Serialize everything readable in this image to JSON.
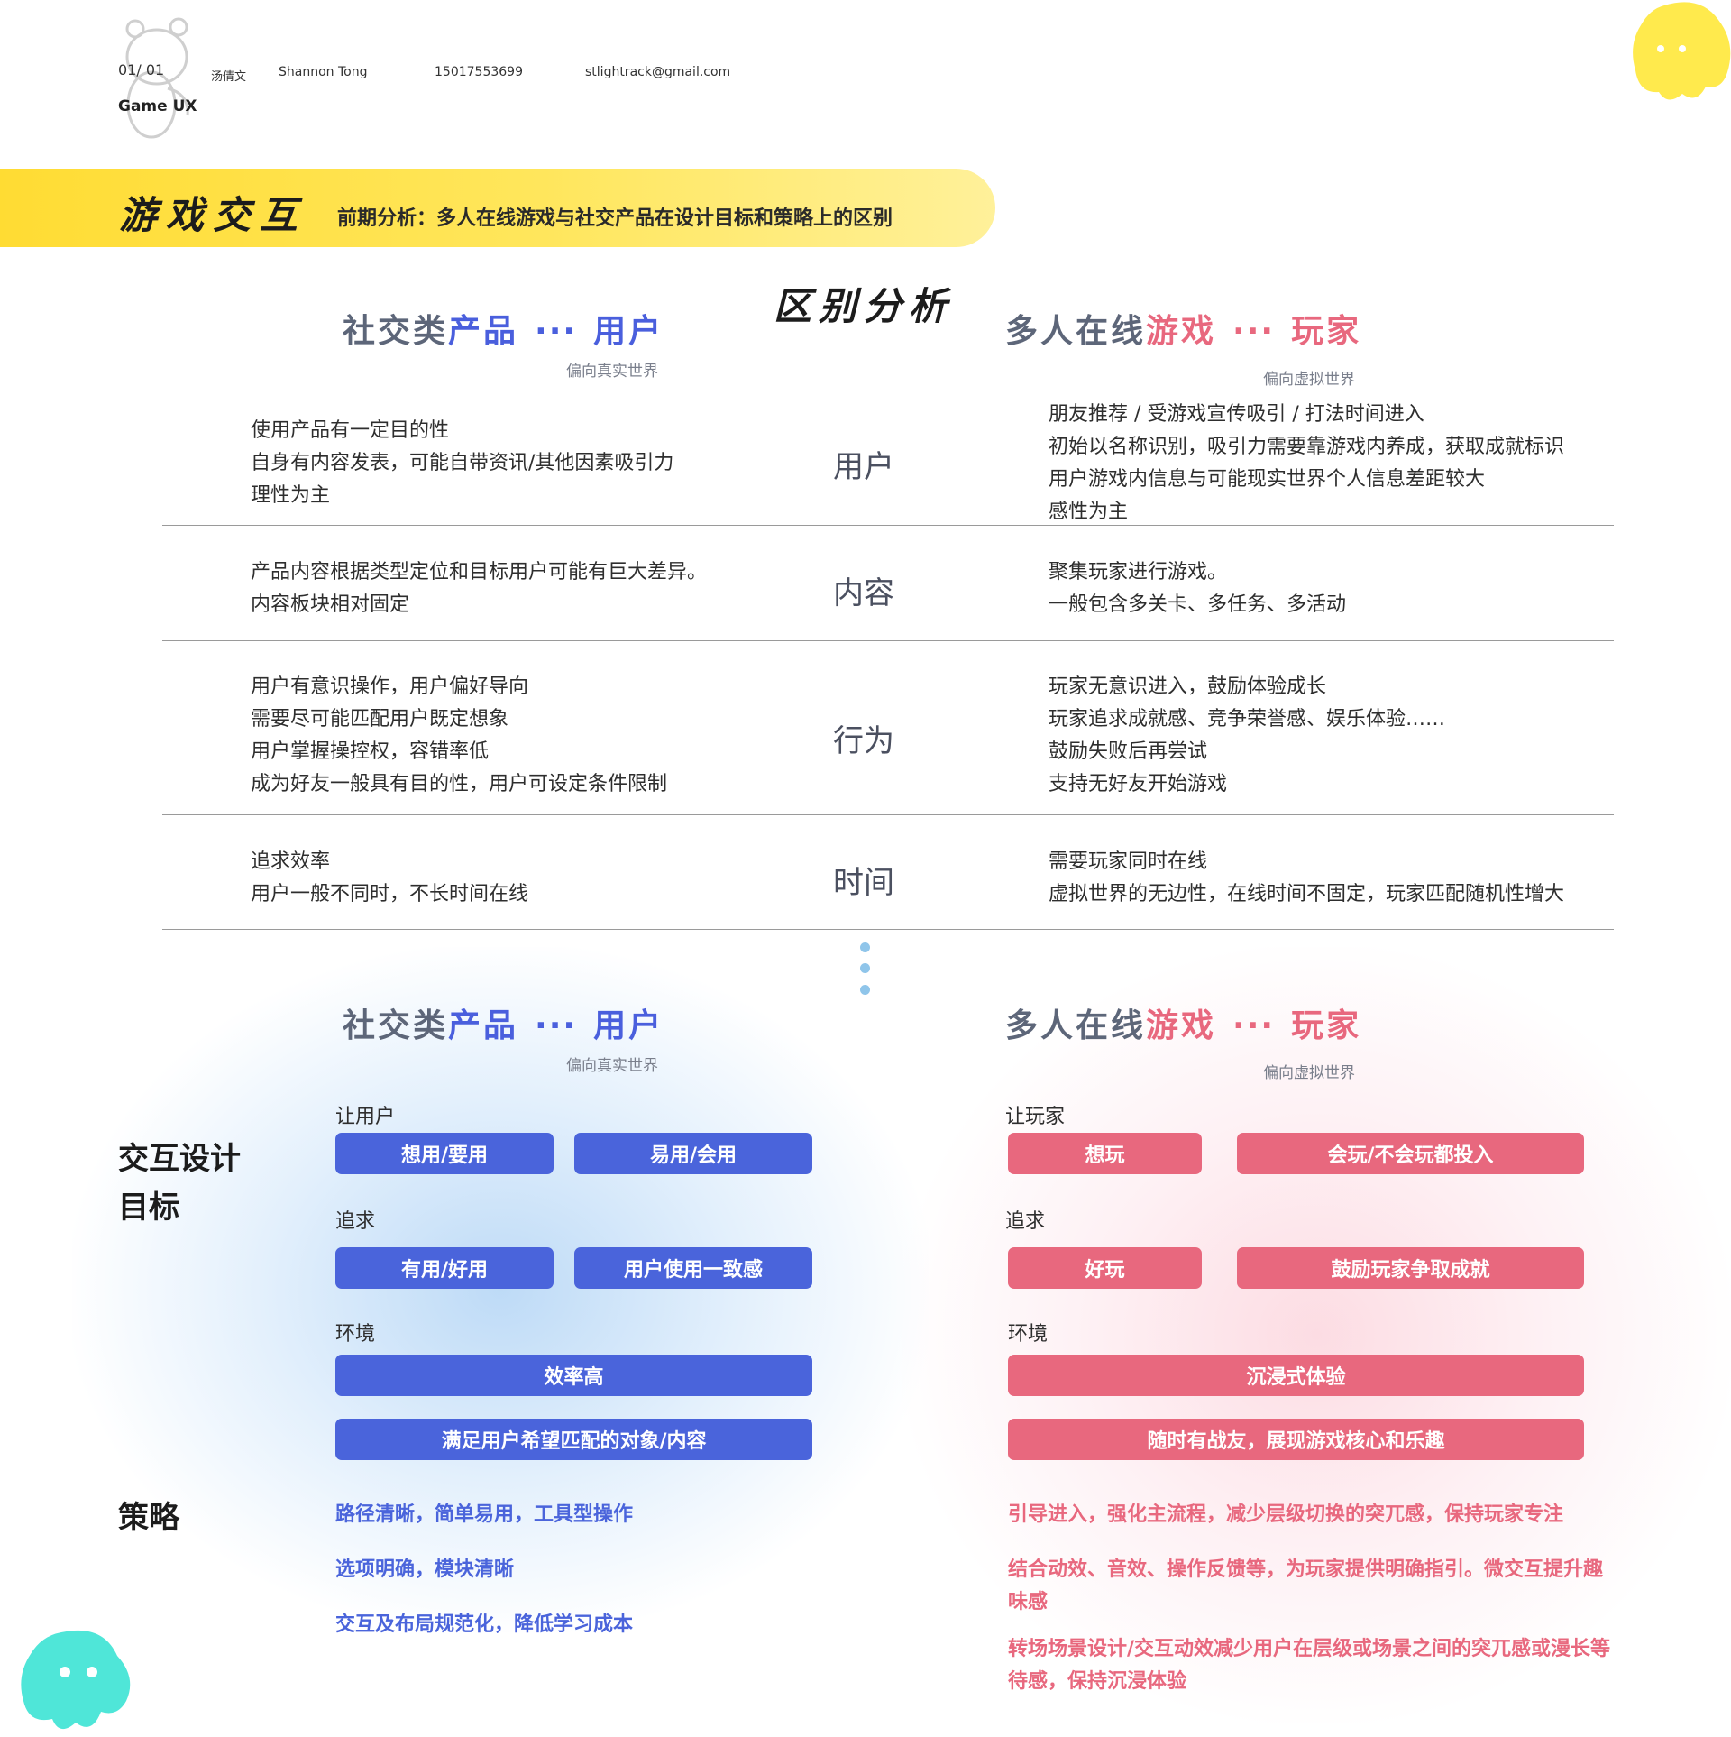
{
  "header": {
    "page": "01/ 01",
    "category": "Game UX",
    "name_cn": "汤倩文",
    "name_en": "Shannon Tong",
    "phone": "15017553699",
    "email": "stlightrack@gmail.com"
  },
  "banner": {
    "title": "游戏交互",
    "subtitle": "前期分析：多人在线游戏与社交产品在设计目标和策略上的区别"
  },
  "section_title": "区别分析",
  "left_head": {
    "a": "社交类",
    "b": "产品",
    "dots": "···",
    "c": "用户",
    "sub": "偏向真实世界"
  },
  "right_head": {
    "a": "多人在线",
    "b": "游戏",
    "dots": "···",
    "c": "玩家",
    "sub": "偏向虚拟世界"
  },
  "rows": [
    {
      "label": "用户",
      "left": [
        "使用产品有一定目的性",
        "自身有内容发表，可能自带资讯/其他因素吸引力",
        "理性为主"
      ],
      "right": [
        "朋友推荐 / 受游戏宣传吸引 / 打法时间进入",
        "初始以名称识别，吸引力需要靠游戏内养成，获取成就标识",
        "用户游戏内信息与可能现实世界个人信息差距较大",
        "感性为主"
      ]
    },
    {
      "label": "内容",
      "left": [
        "产品内容根据类型定位和目标用户可能有巨大差异。",
        "内容板块相对固定"
      ],
      "right": [
        "聚集玩家进行游戏。",
        "一般包含多关卡、多任务、多活动"
      ]
    },
    {
      "label": "行为",
      "left": [
        "用户有意识操作，用户偏好导向",
        "需要尽可能匹配用户既定想象",
        "用户掌握操控权，容错率低",
        "成为好友一般具有目的性，用户可设定条件限制"
      ],
      "right": [
        "玩家无意识进入，鼓励体验成长",
        "玩家追求成就感、竞争荣誉感、娱乐体验……",
        "鼓励失败后再尝试",
        "支持无好友开始游戏"
      ]
    },
    {
      "label": "时间",
      "left": [
        "追求效率",
        "用户一般不同时，不长时间在线"
      ],
      "right": [
        "需要玩家同时在线",
        "虚拟世界的无边性，在线时间不固定，玩家匹配随机性增大"
      ]
    }
  ],
  "goals_label": [
    "交互设计",
    "目标"
  ],
  "strategy_label": "策略",
  "left_goals": {
    "let_label": "让用户",
    "let": [
      "想用/要用",
      "易用/会用"
    ],
    "pursue_label": "追求",
    "pursue": [
      "有用/好用",
      "用户使用一致感"
    ],
    "env_label": "环境",
    "env": [
      "效率高",
      "满足用户希望匹配的对象/内容"
    ]
  },
  "right_goals": {
    "let_label": "让玩家",
    "let": [
      "想玩",
      "会玩/不会玩都投入"
    ],
    "pursue_label": "追求",
    "pursue": [
      "好玩",
      "鼓励玩家争取成就"
    ],
    "env_label": "环境",
    "env": [
      "沉浸式体验",
      "随时有战友，展现游戏核心和乐趣"
    ]
  },
  "left_strategy": [
    "路径清晰，简单易用，工具型操作",
    "选项明确，模块清晰",
    "交互及布局规范化，降低学习成本"
  ],
  "right_strategy": [
    "引导进入，强化主流程，减少层级切换的突兀感，保持玩家专注",
    "结合动效、音效、操作反馈等，为玩家提供明确指引。微交互提升趣味感",
    "转场场景设计/交互动效减少用户在层级或场景之间的突兀感或漫长等待感，保持沉浸体验"
  ],
  "colors": {
    "blue": "#4a64db",
    "pink": "#e8687e",
    "yellow": "#ffda28",
    "cyan": "#4fe6d8"
  }
}
